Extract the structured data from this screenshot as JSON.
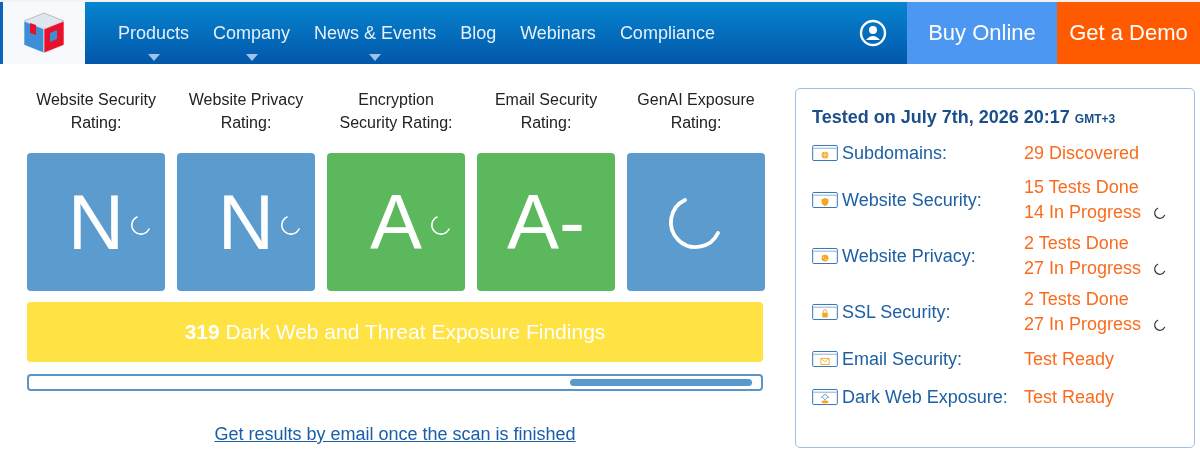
{
  "nav": {
    "items": [
      {
        "label": "Products",
        "dropdown": true
      },
      {
        "label": "Company",
        "dropdown": true
      },
      {
        "label": "News & Events",
        "dropdown": true
      },
      {
        "label": "Blog",
        "dropdown": false
      },
      {
        "label": "Webinars",
        "dropdown": false
      },
      {
        "label": "Compliance",
        "dropdown": false
      }
    ],
    "buy_button": "Buy Online",
    "demo_button": "Get a Demo"
  },
  "ratings": [
    {
      "label": "Website Security Rating:",
      "kind": "grade",
      "grade": "N",
      "color": "#5b9bce",
      "loading": true
    },
    {
      "label": "Website Privacy Rating:",
      "kind": "grade",
      "grade": "N",
      "color": "#5b9bce",
      "loading": true
    },
    {
      "label": "Encryption Security Rating:",
      "kind": "grade",
      "grade": "A",
      "color": "#5cb85c",
      "loading": true
    },
    {
      "label": "Email Security Rating:",
      "kind": "grade",
      "grade": "A-",
      "color": "#5cb85c",
      "loading": false
    },
    {
      "label": "GenAI Exposure Rating:",
      "kind": "pending",
      "color": "#5b9bce",
      "loading": true
    }
  ],
  "findings_banner": "**319** Dark Web and Threat Exposure Findings",
  "email_link": "Get results by email once the scan is finished",
  "summary": {
    "title": "Tested on July 7th, 2026 20:17",
    "timezone": "GMT+3",
    "rows": [
      {
        "kind": "subdomains",
        "label": "Subdomains:",
        "lines": [
          {
            "text": "29 Discovered",
            "loading": false
          }
        ]
      },
      {
        "kind": "security",
        "label": "Website Security:",
        "lines": [
          {
            "text": "15 Tests Done",
            "loading": false
          },
          {
            "text": "14 In Progress",
            "loading": true
          }
        ]
      },
      {
        "kind": "privacy",
        "label": "Website Privacy:",
        "lines": [
          {
            "text": "2 Tests Done",
            "loading": false
          },
          {
            "text": "27 In Progress",
            "loading": true
          }
        ]
      },
      {
        "kind": "ssl",
        "label": "SSL Security:",
        "lines": [
          {
            "text": "2 Tests Done",
            "loading": false
          },
          {
            "text": "27 In Progress",
            "loading": true
          }
        ]
      },
      {
        "kind": "email",
        "label": "Email Security:",
        "lines": [
          {
            "text": "Test Ready",
            "loading": false
          }
        ]
      },
      {
        "kind": "darkweb",
        "label": "Dark Web Exposure:",
        "lines": [
          {
            "text": "Test Ready",
            "loading": false
          }
        ]
      }
    ]
  }
}
